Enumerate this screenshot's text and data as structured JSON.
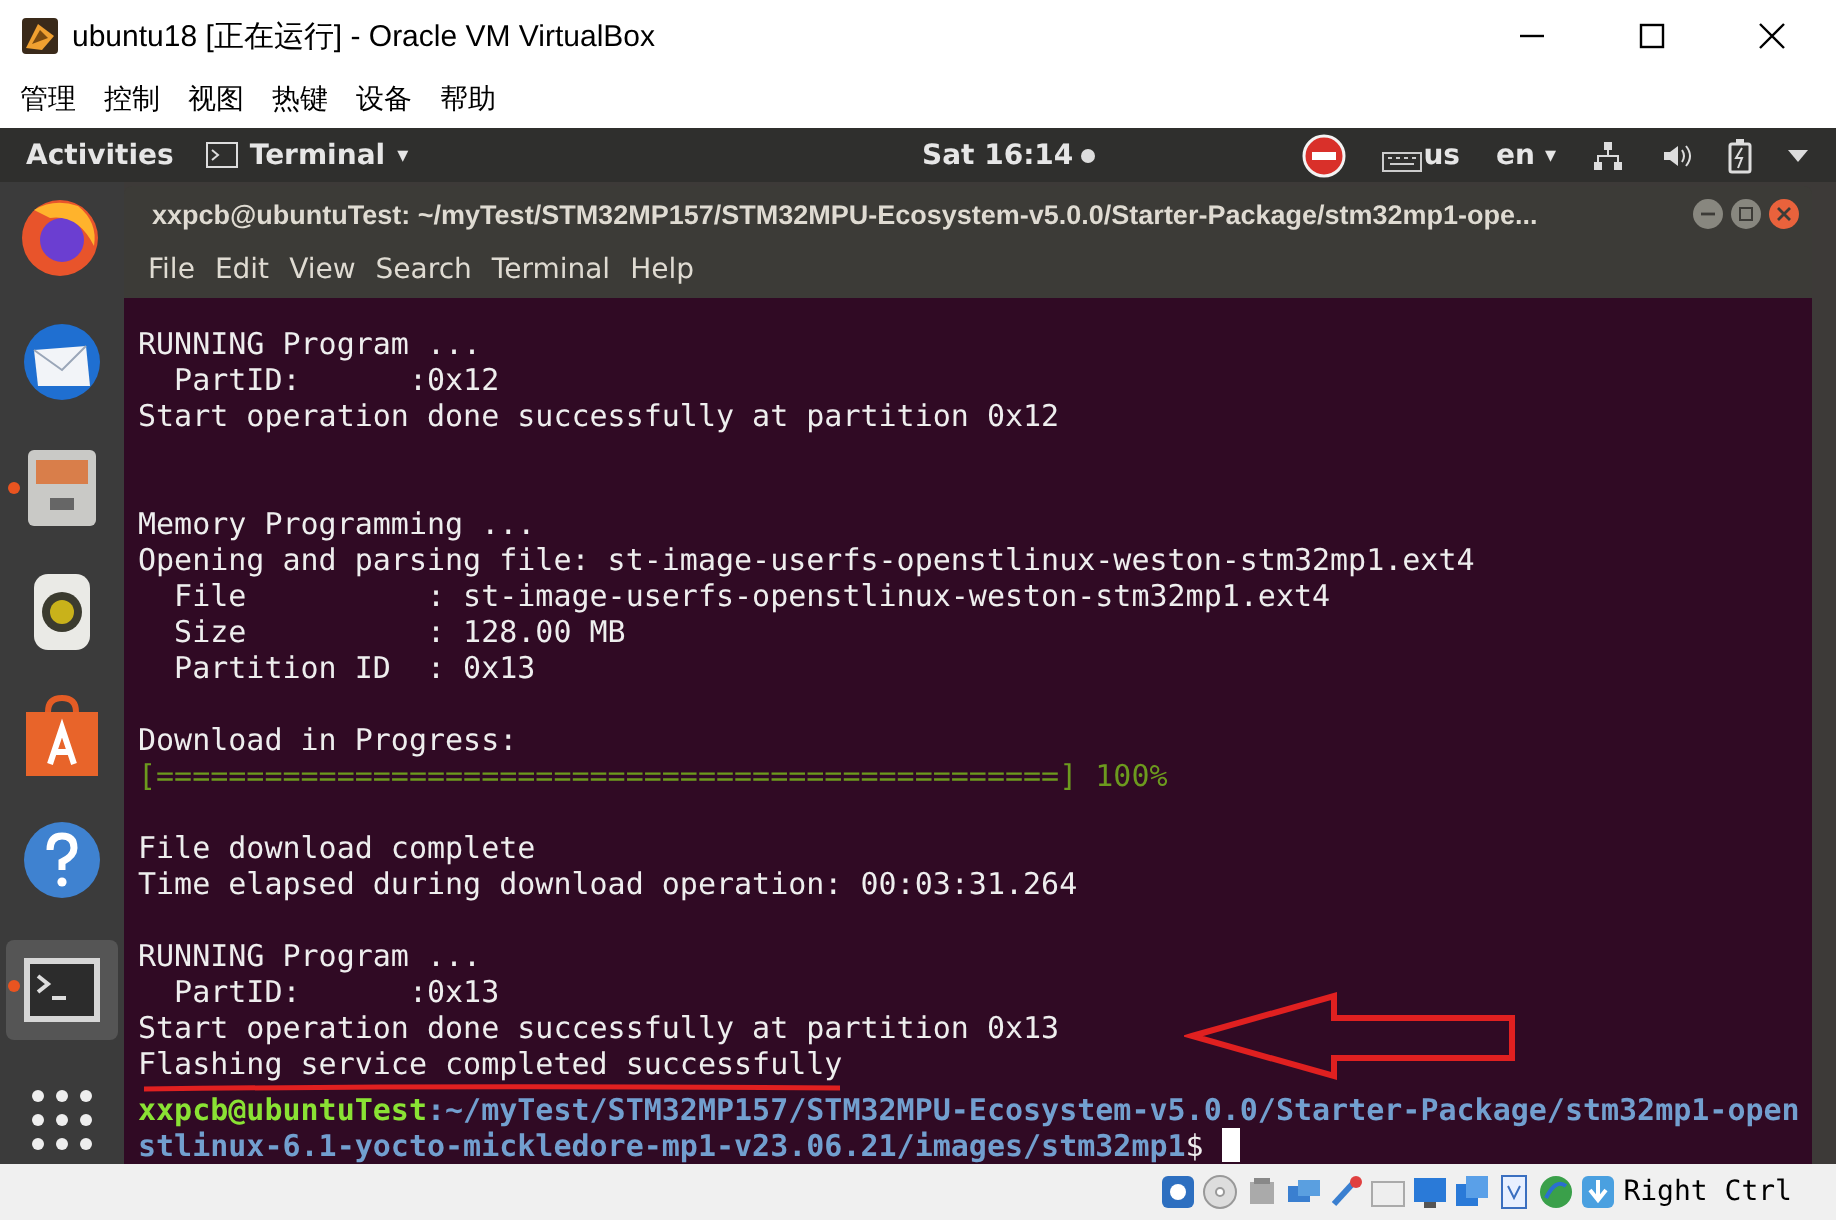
{
  "window": {
    "title": "ubuntu18 [正在运行] - Oracle VM VirtualBox"
  },
  "menu": [
    "管理",
    "控制",
    "视图",
    "热键",
    "设备",
    "帮助"
  ],
  "top_bar": {
    "activities": "Activities",
    "app": "Terminal",
    "app_caret": "▾",
    "clock": "Sat 16:14",
    "keyboard": "us",
    "language": "en",
    "language_caret": "▾"
  },
  "dock": [
    {
      "kind": "firefox",
      "running": false,
      "selected": false
    },
    {
      "kind": "mail",
      "running": false,
      "selected": false
    },
    {
      "kind": "files",
      "running": true,
      "selected": false
    },
    {
      "kind": "speaker",
      "running": false,
      "selected": false
    },
    {
      "kind": "software",
      "running": false,
      "selected": false
    },
    {
      "kind": "help",
      "running": false,
      "selected": false
    },
    {
      "kind": "terminal",
      "running": true,
      "selected": true
    },
    {
      "kind": "apps",
      "running": false,
      "selected": false
    }
  ],
  "terminal": {
    "title": "xxpcb@ubuntuTest: ~/myTest/STM32MP157/STM32MPU-Ecosystem-v5.0.0/Starter-Package/stm32mp1-ope...",
    "menu": [
      "File",
      "Edit",
      "View",
      "Search",
      "Terminal",
      "Help"
    ],
    "lines": [
      {
        "kind": "text",
        "text": "RUNNING Program ..."
      },
      {
        "kind": "text",
        "text": "  PartID:      :0x12"
      },
      {
        "kind": "text",
        "text": "Start operation done successfully at partition 0x12"
      },
      {
        "kind": "blank"
      },
      {
        "kind": "blank"
      },
      {
        "kind": "text",
        "text": "Memory Programming ..."
      },
      {
        "kind": "text",
        "text": "Opening and parsing file: st-image-userfs-openstlinux-weston-stm32mp1.ext4"
      },
      {
        "kind": "text",
        "text": "  File          : st-image-userfs-openstlinux-weston-stm32mp1.ext4"
      },
      {
        "kind": "text",
        "text": "  Size          : 128.00 MB"
      },
      {
        "kind": "text",
        "text": "  Partition ID  : 0x13"
      },
      {
        "kind": "blank"
      },
      {
        "kind": "text",
        "text": "Download in Progress:"
      },
      {
        "kind": "progress",
        "text": "[==================================================] 100%"
      },
      {
        "kind": "blank"
      },
      {
        "kind": "text",
        "text": "File download complete"
      },
      {
        "kind": "text",
        "text": "Time elapsed during download operation: 00:03:31.264"
      },
      {
        "kind": "blank"
      },
      {
        "kind": "text",
        "text": "RUNNING Program ..."
      },
      {
        "kind": "text",
        "text": "  PartID:      :0x13"
      },
      {
        "kind": "text",
        "text": "Start operation done successfully at partition 0x13"
      },
      {
        "kind": "text",
        "text": "Flashing service completed successfully"
      }
    ],
    "prompt": {
      "user_host": "xxpcb@ubuntuTest",
      "path": ":~/myTest/STM32MP157/STM32MPU-Ecosystem-v5.0.0/Starter-Package/stm32mp1-openstlinux-6.1-yocto-mickledore-mp1-v23.06.21/images/stm32mp1",
      "symbol": "$"
    }
  },
  "status_bar": {
    "host_key": "Right Ctrl"
  }
}
